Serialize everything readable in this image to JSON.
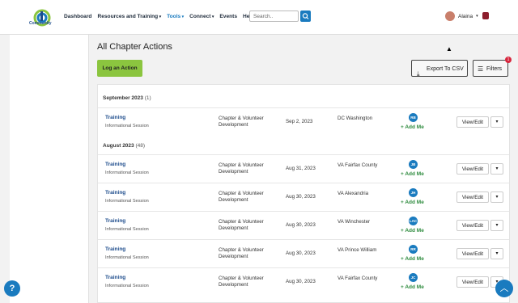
{
  "header": {
    "logo_text": "Community",
    "nav": [
      {
        "label": "Dashboard"
      },
      {
        "label": "Resources and Training"
      },
      {
        "label": "Tools"
      },
      {
        "label": "Connect"
      },
      {
        "label": "Events"
      },
      {
        "label": "Help"
      }
    ],
    "search_placeholder": "Search..",
    "user_name": "Alaina"
  },
  "page": {
    "title": "All Chapter Actions",
    "log_button": "Log an Action",
    "export_button": "Export To CSV",
    "filters_button": "Filters",
    "filters_badge": "1"
  },
  "groups": [
    {
      "label": "September 2023",
      "count": "(1)"
    },
    {
      "label": "August 2023",
      "count": "(48)"
    }
  ],
  "rows": [
    {
      "title": "Training",
      "subtitle": "Informational Session",
      "category": "Chapter & Volunteer Development",
      "date": "Sep 2, 2023",
      "location": "DC Washington",
      "initials": "RB",
      "add": "+ Add Me",
      "view": "View/Edit"
    },
    {
      "title": "Training",
      "subtitle": "Informational Session",
      "category": "Chapter & Volunteer Development",
      "date": "Aug 31, 2023",
      "location": "VA Fairfax County",
      "initials": "JB",
      "add": "+ Add Me",
      "view": "View/Edit"
    },
    {
      "title": "Training",
      "subtitle": "Informational Session",
      "category": "Chapter & Volunteer Development",
      "date": "Aug 30, 2023",
      "location": "VA Alexandria",
      "initials": "JH",
      "add": "+ Add Me",
      "view": "View/Edit"
    },
    {
      "title": "Training",
      "subtitle": "Informational Session",
      "category": "Chapter & Volunteer Development",
      "date": "Aug 30, 2023",
      "location": "VA Winchester",
      "initials": "LAC",
      "add": "+ Add Me",
      "view": "View/Edit"
    },
    {
      "title": "Training",
      "subtitle": "Informational Session",
      "category": "Chapter & Volunteer Development",
      "date": "Aug 30, 2023",
      "location": "VA Prince William",
      "initials": "RR",
      "add": "+ Add Me",
      "view": "View/Edit"
    },
    {
      "title": "Training",
      "subtitle": "Informational Session",
      "category": "Chapter & Volunteer Development",
      "date": "Aug 30, 2023",
      "location": "VA Fairfax County",
      "initials": "JC",
      "add": "+ Add Me",
      "view": "View/Edit"
    }
  ],
  "colors": {
    "accent": "#1a7bbf",
    "primary_button": "#8bc53f",
    "add_me": "#2e8b3e"
  },
  "icons": {
    "help": "question-icon",
    "scroll_top": "chevron-up-icon"
  }
}
